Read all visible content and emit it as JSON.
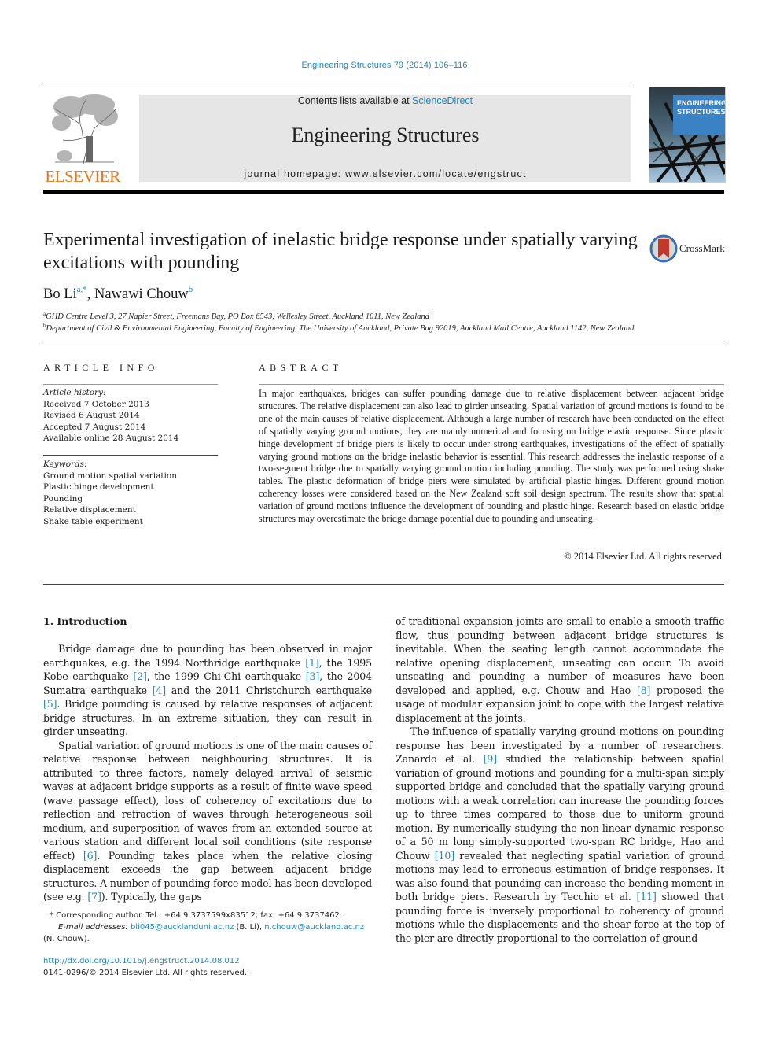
{
  "header": {
    "journal_reference": "Engineering Structures 79 (2014) 106–116",
    "contents_prefix": "Contents lists available at ",
    "contents_link": "ScienceDirect",
    "journal_name": "Engineering Structures",
    "homepage_prefix": "journal homepage: ",
    "homepage_url": "www.elsevier.com/locate/engstruct",
    "publisher_logo_text": "ELSEVIER",
    "cover_title_line1": "ENGINEERING",
    "cover_title_line2": "STRUCTURES",
    "crossmark_label": "CrossMark"
  },
  "article": {
    "title": "Experimental investigation of inelastic bridge response under spatially varying excitations with pounding",
    "authors": [
      {
        "name": "Bo Li",
        "marks": "a,*"
      },
      {
        "name": "Nawawi Chouw",
        "marks": "b"
      }
    ],
    "author_separator": ", ",
    "affiliations": [
      {
        "mark": "a",
        "text": "GHD Centre Level 3, 27 Napier Street, Freemans Bay, PO Box 6543, Wellesley Street, Auckland 1011, New Zealand"
      },
      {
        "mark": "b",
        "text": "Department of Civil & Environmental Engineering, Faculty of Engineering, The University of Auckland, Private Bag 92019, Auckland Mail Centre, Auckland 1142, New Zealand"
      }
    ]
  },
  "article_info": {
    "heading": "ARTICLE INFO",
    "history_label": "Article history:",
    "history": [
      "Received 7 October 2013",
      "Revised 6 August 2014",
      "Accepted 7 August 2014",
      "Available online 28 August 2014"
    ],
    "keywords_label": "Keywords:",
    "keywords": [
      "Ground motion spatial variation",
      "Plastic hinge development",
      "Pounding",
      "Relative displacement",
      "Shake table experiment"
    ]
  },
  "abstract": {
    "heading": "ABSTRACT",
    "text": "In major earthquakes, bridges can suffer pounding damage due to relative displacement between adjacent bridge structures. The relative displacement can also lead to girder unseating. Spatial variation of ground motions is found to be one of the main causes of relative displacement. Although a large number of research have been conducted on the effect of spatially varying ground motions, they are mainly numerical and focusing on bridge elastic response. Since plastic hinge development of bridge piers is likely to occur under strong earthquakes, investigations of the effect of spatially varying ground motions on the bridge inelastic behavior is essential. This research addresses the inelastic response of a two-segment bridge due to spatially varying ground motion including pounding. The study was performed using shake tables. The plastic deformation of bridge piers were simulated by artificial plastic hinges. Different ground motion coherency losses were considered based on the New Zealand soft soil design spectrum. The results show that spatial variation of ground motions influence the development of pounding and plastic hinge. Research based on elastic bridge structures may overestimate the bridge damage potential due to pounding and unseating.",
    "copyright": "© 2014 Elsevier Ltd. All rights reserved."
  },
  "body": {
    "section_heading": "1. Introduction",
    "paragraphs": [
      {
        "column": "left",
        "indent": true,
        "segments": [
          {
            "t": "Bridge damage due to pounding has been observed in major earthquakes, e.g. the 1994 Northridge earthquake "
          },
          {
            "c": "[1]"
          },
          {
            "t": ", the 1995 Kobe earthquake "
          },
          {
            "c": "[2]"
          },
          {
            "t": ", the 1999 Chi-Chi earthquake "
          },
          {
            "c": "[3]"
          },
          {
            "t": ", the 2004 Sumatra earthquake "
          },
          {
            "c": "[4]"
          },
          {
            "t": " and the 2011 Christchurch earthquake "
          },
          {
            "c": "[5]"
          },
          {
            "t": ". Bridge pounding is caused by relative responses of adjacent bridge structures. In an extreme situation, they can result in girder unseating."
          }
        ]
      },
      {
        "column": "left",
        "indent": true,
        "segments": [
          {
            "t": "Spatial variation of ground motions is one of the main causes of relative response between neighbouring structures. It is attributed to three factors, namely delayed arrival of seismic waves at adjacent bridge supports as a result of finite wave speed (wave passage effect), loss of coherency of excitations due to reflection and refraction of waves through heterogeneous soil medium, and superposition of waves from an extended source at various station and different local soil conditions (site response effect) "
          },
          {
            "c": "[6]"
          },
          {
            "t": ". Pounding takes place when the relative closing displacement exceeds the gap between adjacent bridge structures. A number of pounding force model has been developed (see e.g. "
          },
          {
            "c": "[7]"
          },
          {
            "t": "). Typically, the gaps"
          }
        ]
      },
      {
        "column": "right",
        "indent": false,
        "segments": [
          {
            "t": "of traditional expansion joints are small to enable a smooth traffic flow, thus pounding between adjacent bridge structures is inevitable. When the seating length cannot accommodate the relative opening displacement, unseating can occur. To avoid unseating and pounding a number of measures have been developed and applied, e.g. Chouw and Hao "
          },
          {
            "c": "[8]"
          },
          {
            "t": " proposed the usage of modular expansion joint to cope with the largest relative displacement at the joints."
          }
        ]
      },
      {
        "column": "right",
        "indent": true,
        "segments": [
          {
            "t": "The influence of spatially varying ground motions on pounding response has been investigated by a number of researchers. Zanardo et al. "
          },
          {
            "c": "[9]"
          },
          {
            "t": " studied the relationship between spatial variation of ground motions and pounding for a multi-span simply supported bridge and concluded that the spatially varying ground motions with a weak correlation can increase the pounding forces up to three times compared to those due to uniform ground motion. By numerically studying the non-linear dynamic response of a 50 m long simply-supported two-span RC bridge, Hao and Chouw "
          },
          {
            "c": "[10]"
          },
          {
            "t": " revealed that neglecting spatial variation of ground motions may lead to erroneous estimation of bridge responses. It was also found that pounding can increase the bending moment in both bridge piers. Research by Tecchio et al. "
          },
          {
            "c": "[11]"
          },
          {
            "t": " showed that pounding force is inversely proportional to coherency of ground motions while the displacements and the shear force at the top of the pier are directly proportional to the correlation of ground"
          }
        ]
      }
    ]
  },
  "footnote": {
    "corresponding": "* Corresponding author. Tel.: +64 9 3737599x83512; fax: +64 9 3737462.",
    "email_label": "E-mail addresses: ",
    "email1": "bli045@aucklanduni.ac.nz",
    "email1_owner": " (B. Li), ",
    "email2": "n.chouw@auckland.ac.nz",
    "email2_owner": " (N. Chouw).",
    "doi": "http://dx.doi.org/10.1016/j.engstruct.2014.08.012",
    "issn": "0141-0296/© 2014 Elsevier Ltd. All rights reserved."
  },
  "colors": {
    "link": "#1f88b8",
    "elsevier_orange": "#e87722",
    "banner_gray": "#e6e6e6",
    "cover_blue": "#3b82c4"
  }
}
